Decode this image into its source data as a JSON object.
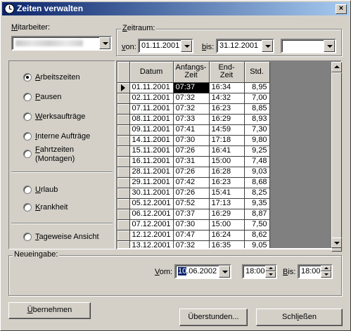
{
  "window": {
    "title": "Zeiten verwalten",
    "close_label": "×"
  },
  "mitarbeiter": {
    "label_u": "M",
    "label_rest": "itarbeiter:"
  },
  "zeitraum": {
    "label_u": "Z",
    "label_rest": "eitraum:",
    "von_label_u": "v",
    "von_label_rest": "on:",
    "von_value": "01.11.2001",
    "bis_label_u": "b",
    "bis_label_rest": "is:",
    "bis_value": "31.12.2001",
    "extra_value": ""
  },
  "options": [
    {
      "u": "A",
      "rest": "rbeitszeiten",
      "checked": true
    },
    {
      "u": "P",
      "rest": "ausen",
      "checked": false
    },
    {
      "u": "W",
      "rest": "erksaufträge",
      "checked": false
    },
    {
      "u": "I",
      "rest": "nterne Aufträge",
      "checked": false
    },
    {
      "u": "F",
      "rest": "ahrtzeiten",
      "line2": "(Montagen)",
      "checked": false
    },
    {
      "u": "U",
      "rest": "rlaub",
      "checked": false
    },
    {
      "u": "K",
      "rest": "rankheit",
      "checked": false
    },
    {
      "u": "T",
      "rest": "ageweise Ansicht",
      "checked": false
    }
  ],
  "table": {
    "columns": [
      "Datum",
      "Anfangs-\nZeit",
      "End-\nZeit",
      "Std."
    ],
    "rows": [
      [
        "01.11.2001",
        "07:37",
        "16:34",
        "8,95"
      ],
      [
        "02.11.2001",
        "07:32",
        "14:32",
        "7,00"
      ],
      [
        "07.11.2001",
        "07:32",
        "16:23",
        "8,85"
      ],
      [
        "08.11.2001",
        "07:33",
        "16:29",
        "8,93"
      ],
      [
        "09.11.2001",
        "07:41",
        "14:59",
        "7,30"
      ],
      [
        "14.11.2001",
        "07:30",
        "17:18",
        "9,80"
      ],
      [
        "15.11.2001",
        "07:26",
        "16:41",
        "9,25"
      ],
      [
        "16.11.2001",
        "07:31",
        "15:00",
        "7,48"
      ],
      [
        "28.11.2001",
        "07:26",
        "16:28",
        "9,03"
      ],
      [
        "29.11.2001",
        "07:42",
        "16:23",
        "8,68"
      ],
      [
        "30.11.2001",
        "07:26",
        "15:41",
        "8,25"
      ],
      [
        "05.12.2001",
        "07:52",
        "17:13",
        "9,35"
      ],
      [
        "06.12.2001",
        "07:37",
        "16:29",
        "8,87"
      ],
      [
        "07.12.2001",
        "07:30",
        "15:00",
        "7,50"
      ],
      [
        "12.12.2001",
        "07:47",
        "16:24",
        "8,62"
      ],
      [
        "13.12.2001",
        "07:32",
        "16:35",
        "9,05"
      ]
    ],
    "selected_row": 0
  },
  "neueingabe": {
    "label": "Neueingabe:",
    "vom_label_u": "V",
    "vom_label_rest": "om:",
    "vom_value_sel": "10",
    "vom_value_rest": ".06.2002",
    "from_time": "18:00",
    "bis_label_u": "B",
    "bis_label_rest": "is:",
    "to_time": "18:00"
  },
  "buttons": {
    "uebernehmen_u": "Ü",
    "uebernehmen_rest": "bernehmen",
    "ueberstunden": "Überstunden...",
    "schliessen_pre": "Schl",
    "schliessen_u": "i",
    "schliessen_rest": "eßen"
  }
}
